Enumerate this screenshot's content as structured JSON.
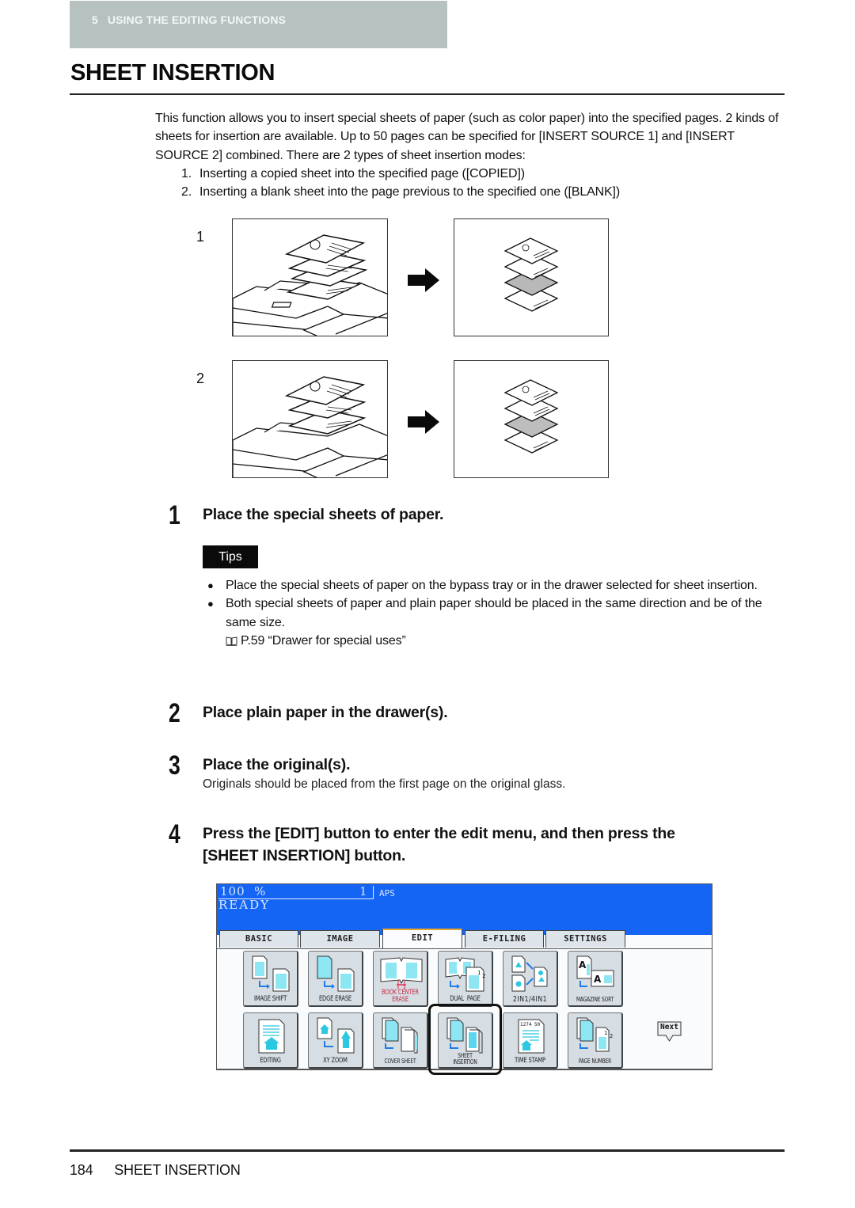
{
  "header": {
    "chapter_label": "5   USING THE EDITING FUNCTIONS",
    "band_color": "#b6c1c0"
  },
  "page_title": "SHEET INSERTION",
  "intro": {
    "paragraph": "This function allows you to insert special sheets of paper (such as color paper) into the specified pages. 2 kinds of sheets for insertion are available. Up to 50 pages can be specified for [INSERT SOURCE 1] and [INSERT SOURCE 2] combined. There are 2 types of sheet insertion modes:",
    "modes": [
      {
        "num": "1.",
        "text": "Inserting a copied sheet into the specified page ([COPIED])"
      },
      {
        "num": "2.",
        "text": "Inserting a blank sheet into the page previous to the specified one ([BLANK])"
      }
    ]
  },
  "figures": [
    {
      "label": "1",
      "mode": "copied",
      "inserted_sheet": "copied page (gray)",
      "arrow_icon": "right-arrow-icon"
    },
    {
      "label": "2",
      "mode": "blank",
      "inserted_sheet": "blank page (gray)",
      "arrow_icon": "right-arrow-icon"
    }
  ],
  "steps": [
    {
      "num": "1",
      "title": "Place the special sheets of paper.",
      "tips": {
        "badge": "Tips",
        "bullets": [
          "Place the special sheets of paper on the bypass tray or in the drawer selected for sheet insertion.",
          "Both special sheets of paper and plain paper should be placed in the same direction and be of the same size."
        ],
        "reference": {
          "icon": "book-reference-icon",
          "text": "P.59 “Drawer for special uses”"
        }
      }
    },
    {
      "num": "2",
      "title": "Place plain paper in the drawer(s)."
    },
    {
      "num": "3",
      "title": "Place the original(s).",
      "description": "Originals should be placed from the first page on the original glass."
    },
    {
      "num": "4",
      "title_line1": "Press the [EDIT] button to enter the edit menu, and then press the",
      "title_line2": "[SHEET INSERTION] button."
    }
  ],
  "panel": {
    "magnification": "100  %",
    "copies": "1",
    "paper": "APS",
    "status": "READY",
    "top_color": "#1565f4",
    "tabs": [
      {
        "label": "BASIC",
        "active": false
      },
      {
        "label": "IMAGE",
        "active": false
      },
      {
        "label": "EDIT",
        "active": true
      },
      {
        "label": "E-FILING",
        "active": false
      },
      {
        "label": "SETTINGS",
        "active": false
      }
    ],
    "buttons_row1": [
      {
        "label": "IMAGE SHIFT",
        "icon": "image-shift-icon"
      },
      {
        "label": "EDGE ERASE",
        "icon": "edge-erase-icon"
      },
      {
        "label": "BOOK CENTER",
        "label2": "ERASE",
        "icon": "book-center-erase-icon"
      },
      {
        "label": "DUAL  PAGE",
        "icon": "dual-page-icon"
      },
      {
        "label": "2IN1/4IN1",
        "icon": "2in1-4in1-icon"
      },
      {
        "label": "MAGAZINE SORT",
        "icon": "magazine-sort-icon"
      }
    ],
    "buttons_row2": [
      {
        "label": "EDITING",
        "icon": "editing-icon"
      },
      {
        "label": "XY ZOOM",
        "icon": "xy-zoom-icon"
      },
      {
        "label": "COVER SHEET",
        "icon": "cover-sheet-icon"
      },
      {
        "label": "SHEET",
        "label2": "INSERTION",
        "icon": "sheet-insertion-icon",
        "highlighted": true
      },
      {
        "label": "TIME STAMP",
        "icon": "time-stamp-icon"
      },
      {
        "label": "PAGE NUMBER",
        "icon": "page-number-icon"
      }
    ],
    "next_label": "Next",
    "time_stamp_text": "1274 50"
  },
  "footer": {
    "page_number": "184",
    "section": "SHEET INSERTION"
  }
}
